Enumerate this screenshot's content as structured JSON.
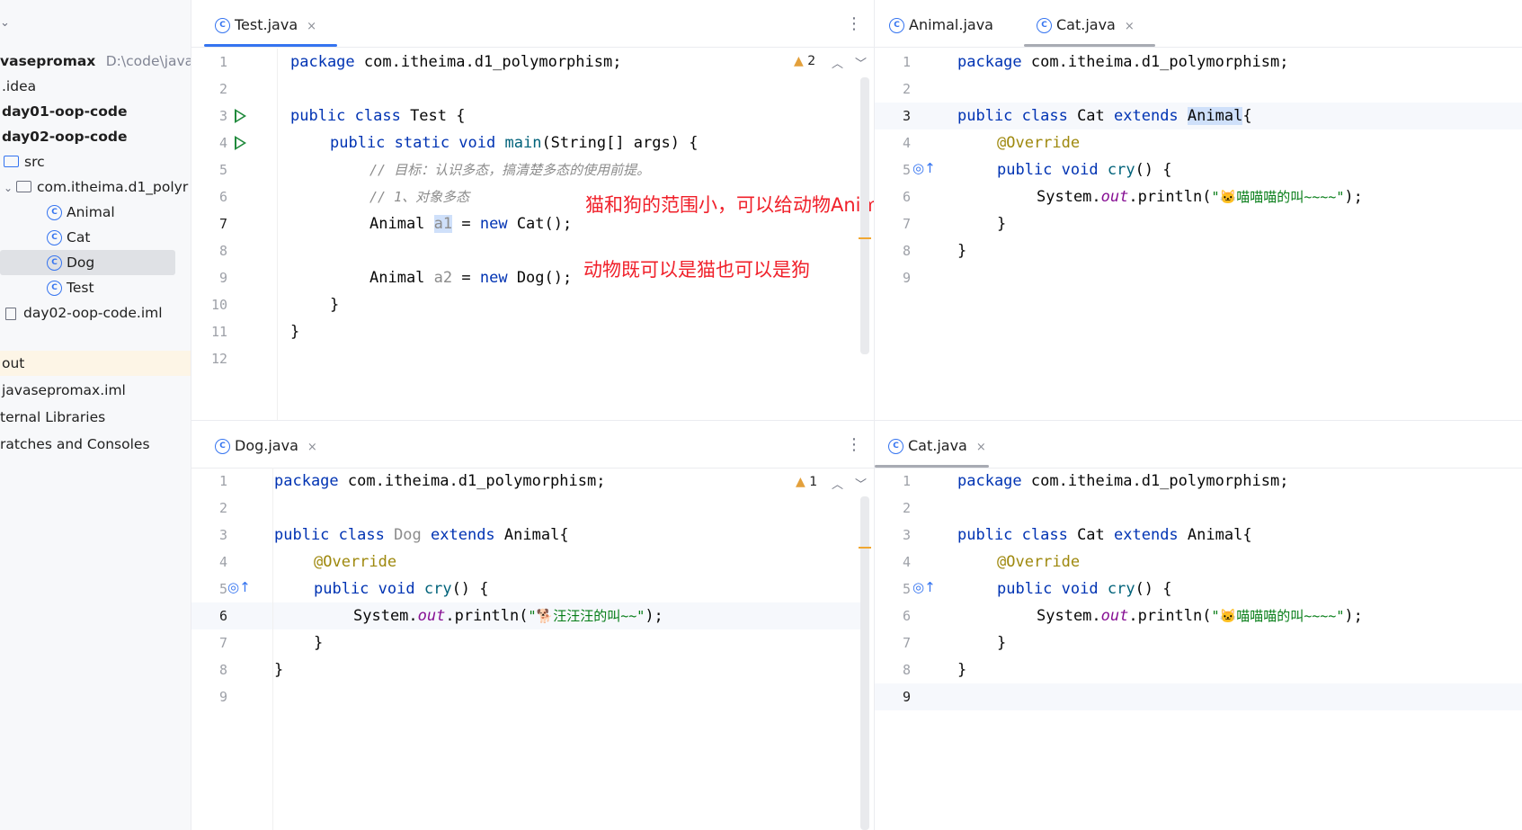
{
  "tree": {
    "root_name": "vasepromax",
    "root_path": "D:\\code\\javas",
    "items": [
      {
        "label": ".idea"
      },
      {
        "label": "day01-oop-code"
      },
      {
        "label": "day02-oop-code"
      },
      {
        "label": "src"
      },
      {
        "label": "com.itheima.d1_polyr"
      },
      {
        "label": "Animal"
      },
      {
        "label": "Cat"
      },
      {
        "label": "Dog"
      },
      {
        "label": "Test"
      },
      {
        "label": "day02-oop-code.iml"
      },
      {
        "label": "out"
      },
      {
        "label": "javasepromax.iml"
      },
      {
        "label": "ternal Libraries"
      },
      {
        "label": "ratches and Consoles"
      }
    ]
  },
  "panes": {
    "top_left": {
      "tabs": [
        {
          "label": "Test.java",
          "close": "×"
        }
      ],
      "warning_count": "2",
      "line_numbers": [
        "1",
        "2",
        "3",
        "4",
        "5",
        "6",
        "7",
        "8",
        "9",
        "10",
        "11",
        "12"
      ],
      "code": {
        "l1_kw": "package",
        "l1_rest": " com.itheima.d1_polymorphism;",
        "l3_kw": "public class",
        "l3_rest": " Test {",
        "l4_kw1": "public static void",
        "l4_fn": "main",
        "l4_rest": "(String[] args) {",
        "l5_cmt": "// 目标：认识多态，搞清楚多态的使用前提。",
        "l6_cmt": "// 1、对象多态",
        "l7_type": "Animal ",
        "l7_var": "a1",
        "l7_eq": " = ",
        "l7_kw": "new",
        "l7_rest": " Cat();",
        "l9_type": "Animal ",
        "l9_var": "a2",
        "l9_eq": " = ",
        "l9_kw": "new",
        "l9_rest": " Dog();",
        "l10": "}",
        "l11": "}"
      },
      "notes": {
        "note1": "猫和狗的范围小，可以给动物Animal",
        "note2": "动物既可以是猫也可以是狗"
      }
    },
    "top_right": {
      "tabs": [
        {
          "label": "Animal.java"
        },
        {
          "label": "Cat.java",
          "close": "×"
        }
      ],
      "line_numbers": [
        "1",
        "2",
        "3",
        "4",
        "5",
        "6",
        "7",
        "8",
        "9"
      ],
      "code": {
        "l1_kw": "package",
        "l1_rest": " com.itheima.d1_polymorphism;",
        "l3_kw1": "public class",
        "l3_name": " Cat ",
        "l3_kw2": "extends",
        "l3_sp": " ",
        "l3_parent": "Animal",
        "l3_brace": "{",
        "l4_ann": "@Override",
        "l5_kw": "public void",
        "l5_fn": "cry",
        "l5_rest": "() {",
        "l6_a": "System.",
        "l6_out": "out",
        "l6_b": ".println(",
        "l6_str": "\"🐱喵喵喵的叫~~~~\"",
        "l6_c": ");",
        "l7": "}",
        "l8": "}"
      }
    },
    "bottom_left": {
      "tabs": [
        {
          "label": "Dog.java",
          "close": "×"
        }
      ],
      "warning_count": "1",
      "line_numbers": [
        "1",
        "2",
        "3",
        "4",
        "5",
        "6",
        "7",
        "8",
        "9"
      ],
      "code": {
        "l1_kw": "package",
        "l1_rest": " com.itheima.d1_polymorphism;",
        "l3_kw1": "public class",
        "l3_name": " Dog ",
        "l3_kw2": "extends",
        "l3_rest": " Animal{",
        "l4_ann": "@Override",
        "l5_kw": "public void",
        "l5_fn": "cry",
        "l5_rest": "() {",
        "l6_a": "System.",
        "l6_out": "out",
        "l6_b": ".println(",
        "l6_str": "\"🐕汪汪汪的叫~~\"",
        "l6_c": ");",
        "l7": "}",
        "l8": "}"
      }
    },
    "bottom_right": {
      "tabs": [
        {
          "label": "Cat.java",
          "close": "×"
        }
      ],
      "line_numbers": [
        "1",
        "2",
        "3",
        "4",
        "5",
        "6",
        "7",
        "8",
        "9"
      ],
      "code": {
        "l1_kw": "package",
        "l1_rest": " com.itheima.d1_polymorphism;",
        "l3_kw1": "public class",
        "l3_name": " Cat ",
        "l3_kw2": "extends",
        "l3_rest": " Animal{",
        "l4_ann": "@Override",
        "l5_kw": "public void",
        "l5_fn": "cry",
        "l5_rest": "() {",
        "l6_a": "System.",
        "l6_out": "out",
        "l6_b": ".println(",
        "l6_str": "\"🐱喵喵喵的叫~~~~\"",
        "l6_c": ");",
        "l7": "}",
        "l8": "}"
      }
    }
  },
  "icons": {
    "class": "C",
    "run": "run-icon",
    "override": "override-icon",
    "warning": "warning-icon",
    "kebab": "⋮",
    "up": "⌃",
    "down": "⌄"
  },
  "colors": {
    "accent": "#3574f0",
    "annotation_red": "#f0202a",
    "keyword": "#0033b3",
    "string": "#067d17"
  }
}
